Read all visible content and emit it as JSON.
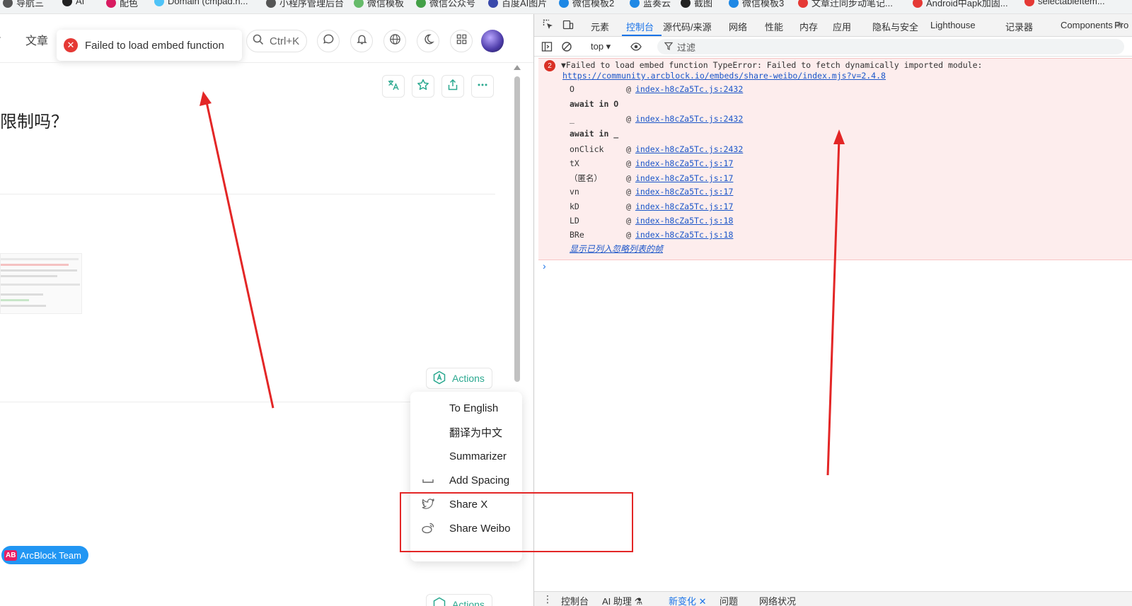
{
  "bookmarks": [
    {
      "label": "导航三",
      "color": "#555"
    },
    {
      "label": "AI",
      "color": "#222"
    },
    {
      "label": "配色",
      "color": "#d81b60"
    },
    {
      "label": "Domain (cmpad.n...",
      "color": "#4fc3f7"
    },
    {
      "label": "小程序管理后台",
      "color": "#555"
    },
    {
      "label": "微信模板",
      "color": "#66bb6a"
    },
    {
      "label": "微信公众号",
      "color": "#43a047"
    },
    {
      "label": "百度AI图片",
      "color": "#3949ab"
    },
    {
      "label": "微信模板2",
      "color": "#1e88e5"
    },
    {
      "label": "蓝奏云",
      "color": "#1e88e5"
    },
    {
      "label": "截图",
      "color": "#222"
    },
    {
      "label": "微信模板3",
      "color": "#1e88e5"
    },
    {
      "label": "文章迁同步动笔记...",
      "color": "#e53935"
    },
    {
      "label": "Android中apk加固...",
      "color": "#e53935"
    },
    {
      "label": "selectableItem...",
      "color": "#e53935"
    }
  ],
  "site": {
    "nav_articles": "文章",
    "toast_text": "Failed to load embed function",
    "search_shortcut": "Ctrl+K",
    "heading": "限制吗？",
    "actions_label": "Actions",
    "actions_label_bottom": "Actions",
    "menu": [
      {
        "label": "To English",
        "icon": "none"
      },
      {
        "label": "翻译为中文",
        "icon": "none"
      },
      {
        "label": "Summarizer",
        "icon": "none"
      },
      {
        "label": "Add Spacing",
        "icon": "spacing-icon"
      },
      {
        "label": "Share X",
        "icon": "twitter-bird-icon"
      },
      {
        "label": "Share Weibo",
        "icon": "weibo-icon"
      }
    ],
    "team_badge_short": "AB",
    "team_badge_label": "ArcBlock Team"
  },
  "devtools": {
    "tabs": [
      "元素",
      "控制台",
      "源代码/来源",
      "网络",
      "性能",
      "内存",
      "应用",
      "隐私与安全",
      "Lighthouse",
      "记录器",
      "Components ⚛",
      "Pro"
    ],
    "active_tab": "控制台",
    "context": "top ▾",
    "filter_placeholder": "过滤",
    "error_count": "2",
    "error_message": "▼Failed to load embed function TypeError: Failed to fetch dynamically imported module:",
    "error_url": "https://community.arcblock.io/embeds/share-weibo/index.mjs?v=2.4.8",
    "stack": [
      {
        "kind": "frame",
        "fn": "O",
        "loc": "index-h8cZa5Tc.js:2432"
      },
      {
        "kind": "await",
        "text": "await in O"
      },
      {
        "kind": "frame",
        "fn": "_",
        "loc": "index-h8cZa5Tc.js:2432"
      },
      {
        "kind": "await",
        "text": "await in _"
      },
      {
        "kind": "frame",
        "fn": "onClick",
        "loc": "index-h8cZa5Tc.js:2432"
      },
      {
        "kind": "frame",
        "fn": "tX",
        "loc": "index-h8cZa5Tc.js:17"
      },
      {
        "kind": "frame",
        "fn": "（匿名）",
        "loc": "index-h8cZa5Tc.js:17"
      },
      {
        "kind": "frame",
        "fn": "vn",
        "loc": "index-h8cZa5Tc.js:17"
      },
      {
        "kind": "frame",
        "fn": "kD",
        "loc": "index-h8cZa5Tc.js:17"
      },
      {
        "kind": "frame",
        "fn": "LD",
        "loc": "index-h8cZa5Tc.js:18"
      },
      {
        "kind": "frame",
        "fn": "BRe",
        "loc": "index-h8cZa5Tc.js:18"
      }
    ],
    "ignore_list_link": "显示已列入忽略列表的帧",
    "prompt": "›",
    "drawer_tabs": [
      "控制台",
      "AI 助理 ⚗",
      "新变化 ✕",
      "问题",
      "网络状况"
    ],
    "drawer_active": "新变化 ✕"
  },
  "annotation_colors": {
    "arrow": "#e32626"
  }
}
